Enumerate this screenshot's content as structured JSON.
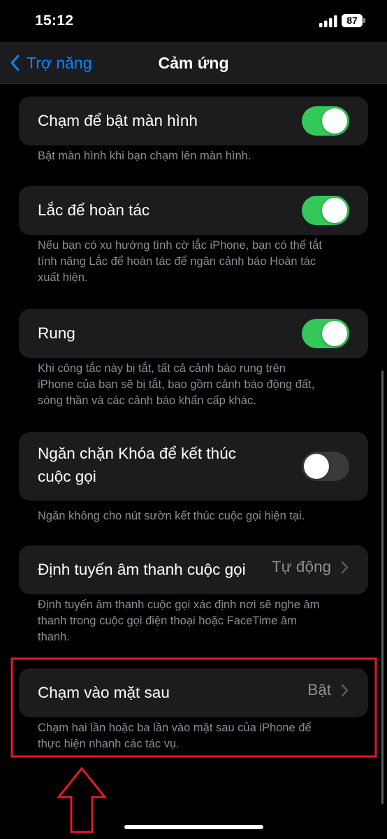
{
  "status_bar": {
    "time": "15:12",
    "battery": "87"
  },
  "nav": {
    "back_label": "Trợ năng",
    "title": "Cảm ứng"
  },
  "settings": [
    {
      "label": "Chạm để bật màn hình",
      "toggle": true,
      "footer": "Bật màn hình khi bạn chạm lên màn hình."
    },
    {
      "label": "Lắc để hoàn tác",
      "toggle": true,
      "footer_lines": [
        "Nếu bạn có xu hướng tình cờ lắc iPhone, bạn có thể tắt",
        "tính năng Lắc để hoàn tác để ngăn cảnh báo Hoàn tác",
        "xuất hiện."
      ]
    },
    {
      "label": "Rung",
      "toggle": true,
      "footer_lines": [
        "Khi công tắc này bị tắt, tất cả cảnh báo rung trên",
        "iPhone của bạn sẽ bị tắt, bao gồm cảnh báo động đất,",
        "sóng thần và các cảnh báo khẩn cấp khác."
      ]
    },
    {
      "label_lines": [
        "Ngăn chặn Khóa để kết thúc",
        "cuộc gọi"
      ],
      "toggle": false,
      "footer": "Ngăn không cho nút sườn kết thúc cuộc gọi hiện tại."
    },
    {
      "label": "Định tuyến âm thanh cuộc gọi",
      "value": "Tự động",
      "footer_lines": [
        "Định tuyến âm thanh cuộc gọi xác định nơi sẽ nghe âm",
        "thanh trong cuộc gọi điện thoại hoặc FaceTime âm",
        "thanh."
      ]
    },
    {
      "label": "Chạm vào mặt sau",
      "value": "Bật",
      "footer_lines": [
        "Chạm hai lần hoặc ba lần vào mặt sau của iPhone để",
        "thực hiện nhanh các tác vụ."
      ]
    }
  ],
  "colors": {
    "accent": "#0a84ff",
    "toggle_on": "#34c759",
    "toggle_off": "#3a3a3c",
    "annotation": "#e3192b"
  }
}
